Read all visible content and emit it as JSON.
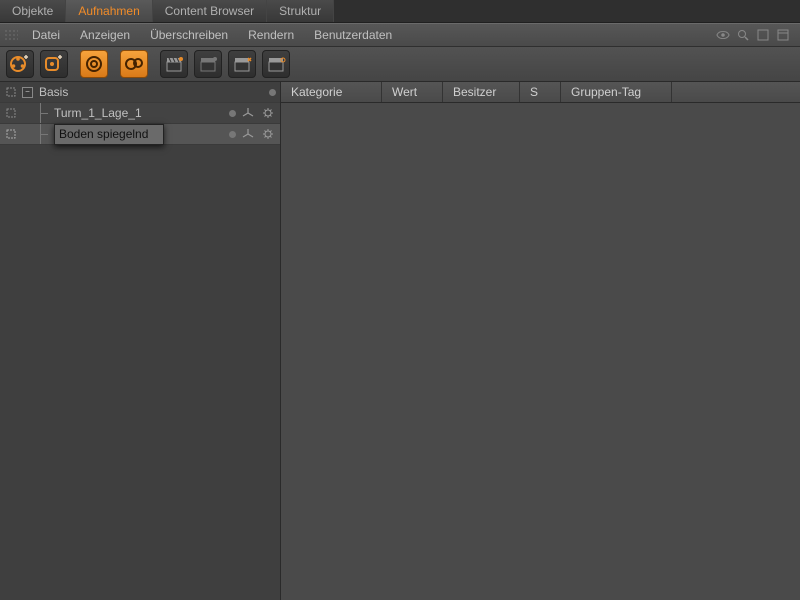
{
  "tabs": [
    "Objekte",
    "Aufnahmen",
    "Content Browser",
    "Struktur"
  ],
  "active_tab": 1,
  "menu": [
    "Datei",
    "Anzeigen",
    "Überschreiben",
    "Rendern",
    "Benutzerdaten"
  ],
  "tree": {
    "root": {
      "label": "Basis"
    },
    "child1": {
      "label": "Turm_1_Lage_1"
    },
    "child2_editing": {
      "value": "Boden spiegelnd"
    }
  },
  "grid": {
    "headers": [
      "Kategorie",
      "Wert",
      "Besitzer",
      "S",
      "Gruppen-Tag"
    ]
  }
}
